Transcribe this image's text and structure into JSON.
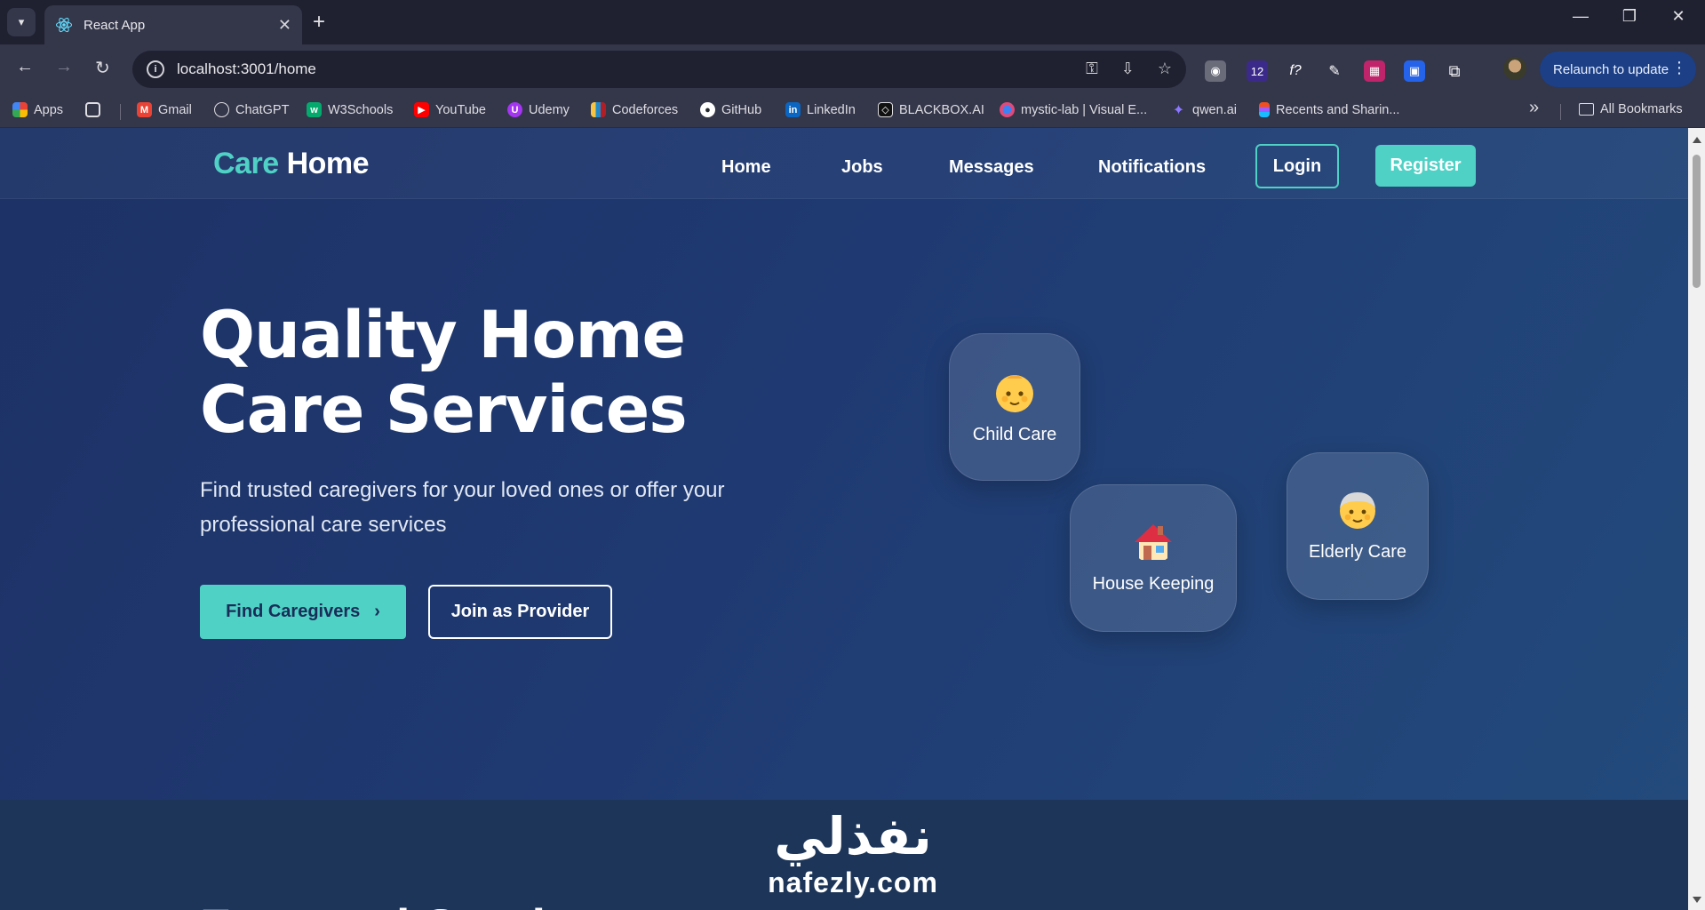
{
  "browser": {
    "tab": {
      "title": "React App",
      "close": "✕"
    },
    "new_tab": "+",
    "window_controls": {
      "minimize": "—",
      "restore": "❐",
      "close": "✕"
    },
    "nav": {
      "back": "←",
      "forward": "→",
      "reload": "↻"
    },
    "address": "localhost:3001/home",
    "relaunch_label": "Relaunch to update",
    "extension_badge": "12",
    "bookmarks": [
      {
        "label": "Apps",
        "icon": "apps-grid-icon",
        "color": "#e8453c"
      },
      {
        "label": "Gmail",
        "icon": "gmail-icon",
        "color": "#ea4335"
      },
      {
        "label": "ChatGPT",
        "icon": "chatgpt-icon",
        "color": "#dedee3"
      },
      {
        "label": "W3Schools",
        "icon": "w3schools-icon",
        "color": "#04aa6d"
      },
      {
        "label": "YouTube",
        "icon": "youtube-icon",
        "color": "#ff0000"
      },
      {
        "label": "Udemy",
        "icon": "udemy-icon",
        "color": "#a435f0"
      },
      {
        "label": "Codeforces",
        "icon": "codeforces-icon",
        "color": "#f6c343"
      },
      {
        "label": "GitHub",
        "icon": "github-icon",
        "color": "#ffffff"
      },
      {
        "label": "LinkedIn",
        "icon": "linkedin-icon",
        "color": "#0a66c2"
      },
      {
        "label": "BLACKBOX.AI",
        "icon": "blackbox-icon",
        "color": "#111111"
      },
      {
        "label": "mystic-lab | Visual E...",
        "icon": "mystic-lab-icon",
        "color": "#e04a7a"
      },
      {
        "label": "qwen.ai",
        "icon": "qwen-icon",
        "color": "#7b61ff"
      },
      {
        "label": "Recents and Sharin...",
        "icon": "figma-icon",
        "color": "#f24e1e"
      }
    ],
    "all_bookmarks": "All Bookmarks",
    "more_bookmarks": "»"
  },
  "site": {
    "logo": {
      "part1": "Care",
      "part2": "Home"
    },
    "nav": [
      "Home",
      "Jobs",
      "Messages",
      "Notifications"
    ],
    "login": "Login",
    "register": "Register",
    "hero": {
      "title": "Quality Home Care Services",
      "subtitle": "Find trusted caregivers for your loved ones or offer your professional care services",
      "primary_cta": "Find Caregivers",
      "primary_cta_arrow": "›",
      "secondary_cta": "Join as Provider"
    },
    "services": [
      {
        "label": "Child Care",
        "icon": "baby-face-icon"
      },
      {
        "label": "House Keeping",
        "icon": "house-icon"
      },
      {
        "label": "Elderly Care",
        "icon": "older-person-icon"
      }
    ],
    "next_section_title": "Featured Services"
  },
  "watermark": {
    "arabic": "نفذلي",
    "latin": "nafezly.com"
  },
  "colors": {
    "accent": "#4fd1c5",
    "hero_bg": "#1f3a72",
    "chrome_bg": "#34364a"
  }
}
